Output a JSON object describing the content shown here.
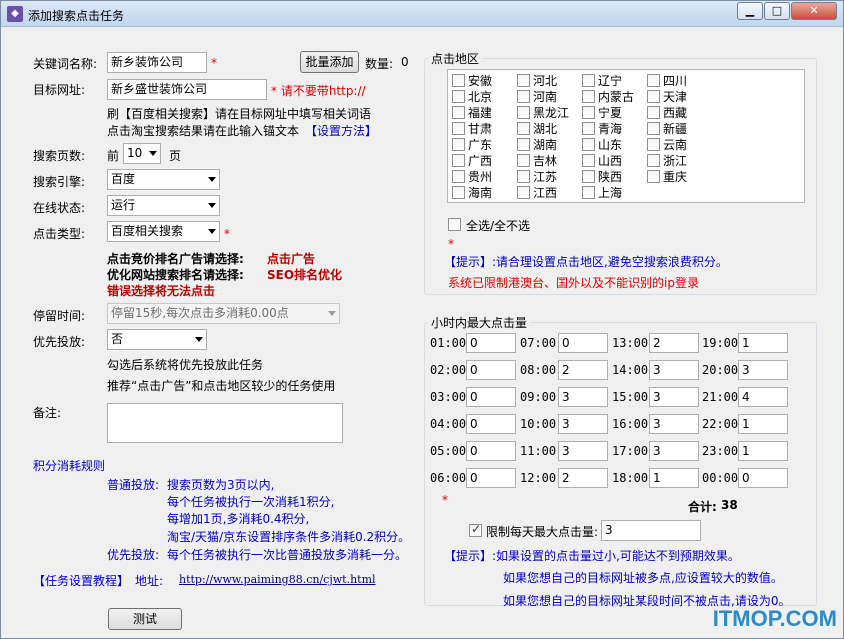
{
  "window": {
    "title": "添加搜索点击任务",
    "btn_min": "▁",
    "btn_max": "□",
    "btn_close": "✕"
  },
  "left": {
    "keyword": {
      "label": "关键词名称:",
      "value": "新乡装饰公司",
      "required": "*",
      "batch_btn": "批量添加",
      "count_label": "数量:",
      "count_value": "0"
    },
    "target_url": {
      "label": "目标网址:",
      "value": "新乡盛世装饰公司",
      "hint": "* 请不要带http://"
    },
    "tip1": "刷【百度相关搜索】请在目标网址中填写相关词语",
    "tip2": "点击淘宝搜索结果请在此输入锚文本",
    "tip2_link": "【设置方法】",
    "pages": {
      "label": "搜索页数:",
      "prefix": "前",
      "value": "10",
      "suffix": "页"
    },
    "engine": {
      "label": "搜索引擎:",
      "value": "百度"
    },
    "status": {
      "label": "在线状态:",
      "value": "运行"
    },
    "click_type": {
      "label": "点击类型:",
      "value": "百度相关搜索",
      "required": "*"
    },
    "note1_a": "点击竞价排名广告请选择:",
    "note1_b": "点击广告",
    "note2_a": "优化网站搜索排名请选择:",
    "note2_b": "SEO排名优化",
    "note3": "错误选择将无法点击",
    "stay": {
      "label": "停留时间:",
      "value": "停留15秒,每次点击多消耗0.00点"
    },
    "priority": {
      "label": "优先投放:",
      "value": "否"
    },
    "priority_tip1": "勾选后系统将优先投放此任务",
    "priority_tip2": "推荐“点击广告”和点击地区较少的任务使用",
    "remark_label": "备注:",
    "rules_title": "积分消耗规则",
    "rule_normal_label": "普通投放:",
    "rule_normal_1": "搜索页数为3页以内,",
    "rule_normal_2": "每个任务被执行一次消耗1积分,",
    "rule_normal_3": "每增加1页,多消耗0.4积分,",
    "rule_normal_4": "淘宝/天猫/京东设置排序条件多消耗0.2积分。",
    "rule_priority_label": "优先投放:",
    "rule_priority": "每个任务被执行一次比普通投放多消耗一分。",
    "tutorial_label": "【任务设置教程】",
    "address_label": "地址:",
    "address_url": "http://www.paiming88.cn/cjwt.html",
    "test_btn": "测试"
  },
  "region": {
    "title": "点击地区",
    "items": [
      "安徽",
      "河北",
      "辽宁",
      "四川",
      "北京",
      "河南",
      "内蒙古",
      "天津",
      "福建",
      "黑龙江",
      "宁夏",
      "西藏",
      "甘肃",
      "湖北",
      "青海",
      "新疆",
      "广东",
      "湖南",
      "山东",
      "云南",
      "广西",
      "吉林",
      "山西",
      "浙江",
      "贵州",
      "江苏",
      "陕西",
      "重庆",
      "海南",
      "江西",
      "上海"
    ],
    "select_all": "全选/全不选",
    "star": "*",
    "tip_label": "【提示】",
    "tip_text": ":请合理设置点击地区,避免空搜索浪费积分。",
    "restrict": "系统已限制港澳台、国外以及不能识别的ip登录"
  },
  "hourly": {
    "title": "小时内最大点击量",
    "hours": [
      {
        "h": "01:00",
        "v": "0"
      },
      {
        "h": "07:00",
        "v": "0"
      },
      {
        "h": "13:00",
        "v": "2"
      },
      {
        "h": "19:00",
        "v": "1"
      },
      {
        "h": "02:00",
        "v": "0"
      },
      {
        "h": "08:00",
        "v": "2"
      },
      {
        "h": "14:00",
        "v": "3"
      },
      {
        "h": "20:00",
        "v": "3"
      },
      {
        "h": "03:00",
        "v": "0"
      },
      {
        "h": "09:00",
        "v": "3"
      },
      {
        "h": "15:00",
        "v": "3"
      },
      {
        "h": "21:00",
        "v": "4"
      },
      {
        "h": "04:00",
        "v": "0"
      },
      {
        "h": "10:00",
        "v": "3"
      },
      {
        "h": "16:00",
        "v": "3"
      },
      {
        "h": "22:00",
        "v": "1"
      },
      {
        "h": "05:00",
        "v": "0"
      },
      {
        "h": "11:00",
        "v": "3"
      },
      {
        "h": "17:00",
        "v": "3"
      },
      {
        "h": "23:00",
        "v": "1"
      },
      {
        "h": "06:00",
        "v": "0"
      },
      {
        "h": "12:00",
        "v": "2"
      },
      {
        "h": "18:00",
        "v": "1"
      },
      {
        "h": "00:00",
        "v": "0"
      }
    ],
    "star": "*",
    "total_label": "合计:",
    "total_value": "38",
    "daily_limit_label": "限制每天最大点击量:",
    "daily_limit_value": "3",
    "tip_label": "【提示】",
    "tip1": ":如果设置的点击量过小,可能达不到预期效果。",
    "tip2": "如果您想自己的目标网址被多点,应设置较大的数值。",
    "tip3": "如果您想自己的目标网址某段时间不被点击,请设为0。"
  },
  "watermark": "ITMOP.COM"
}
